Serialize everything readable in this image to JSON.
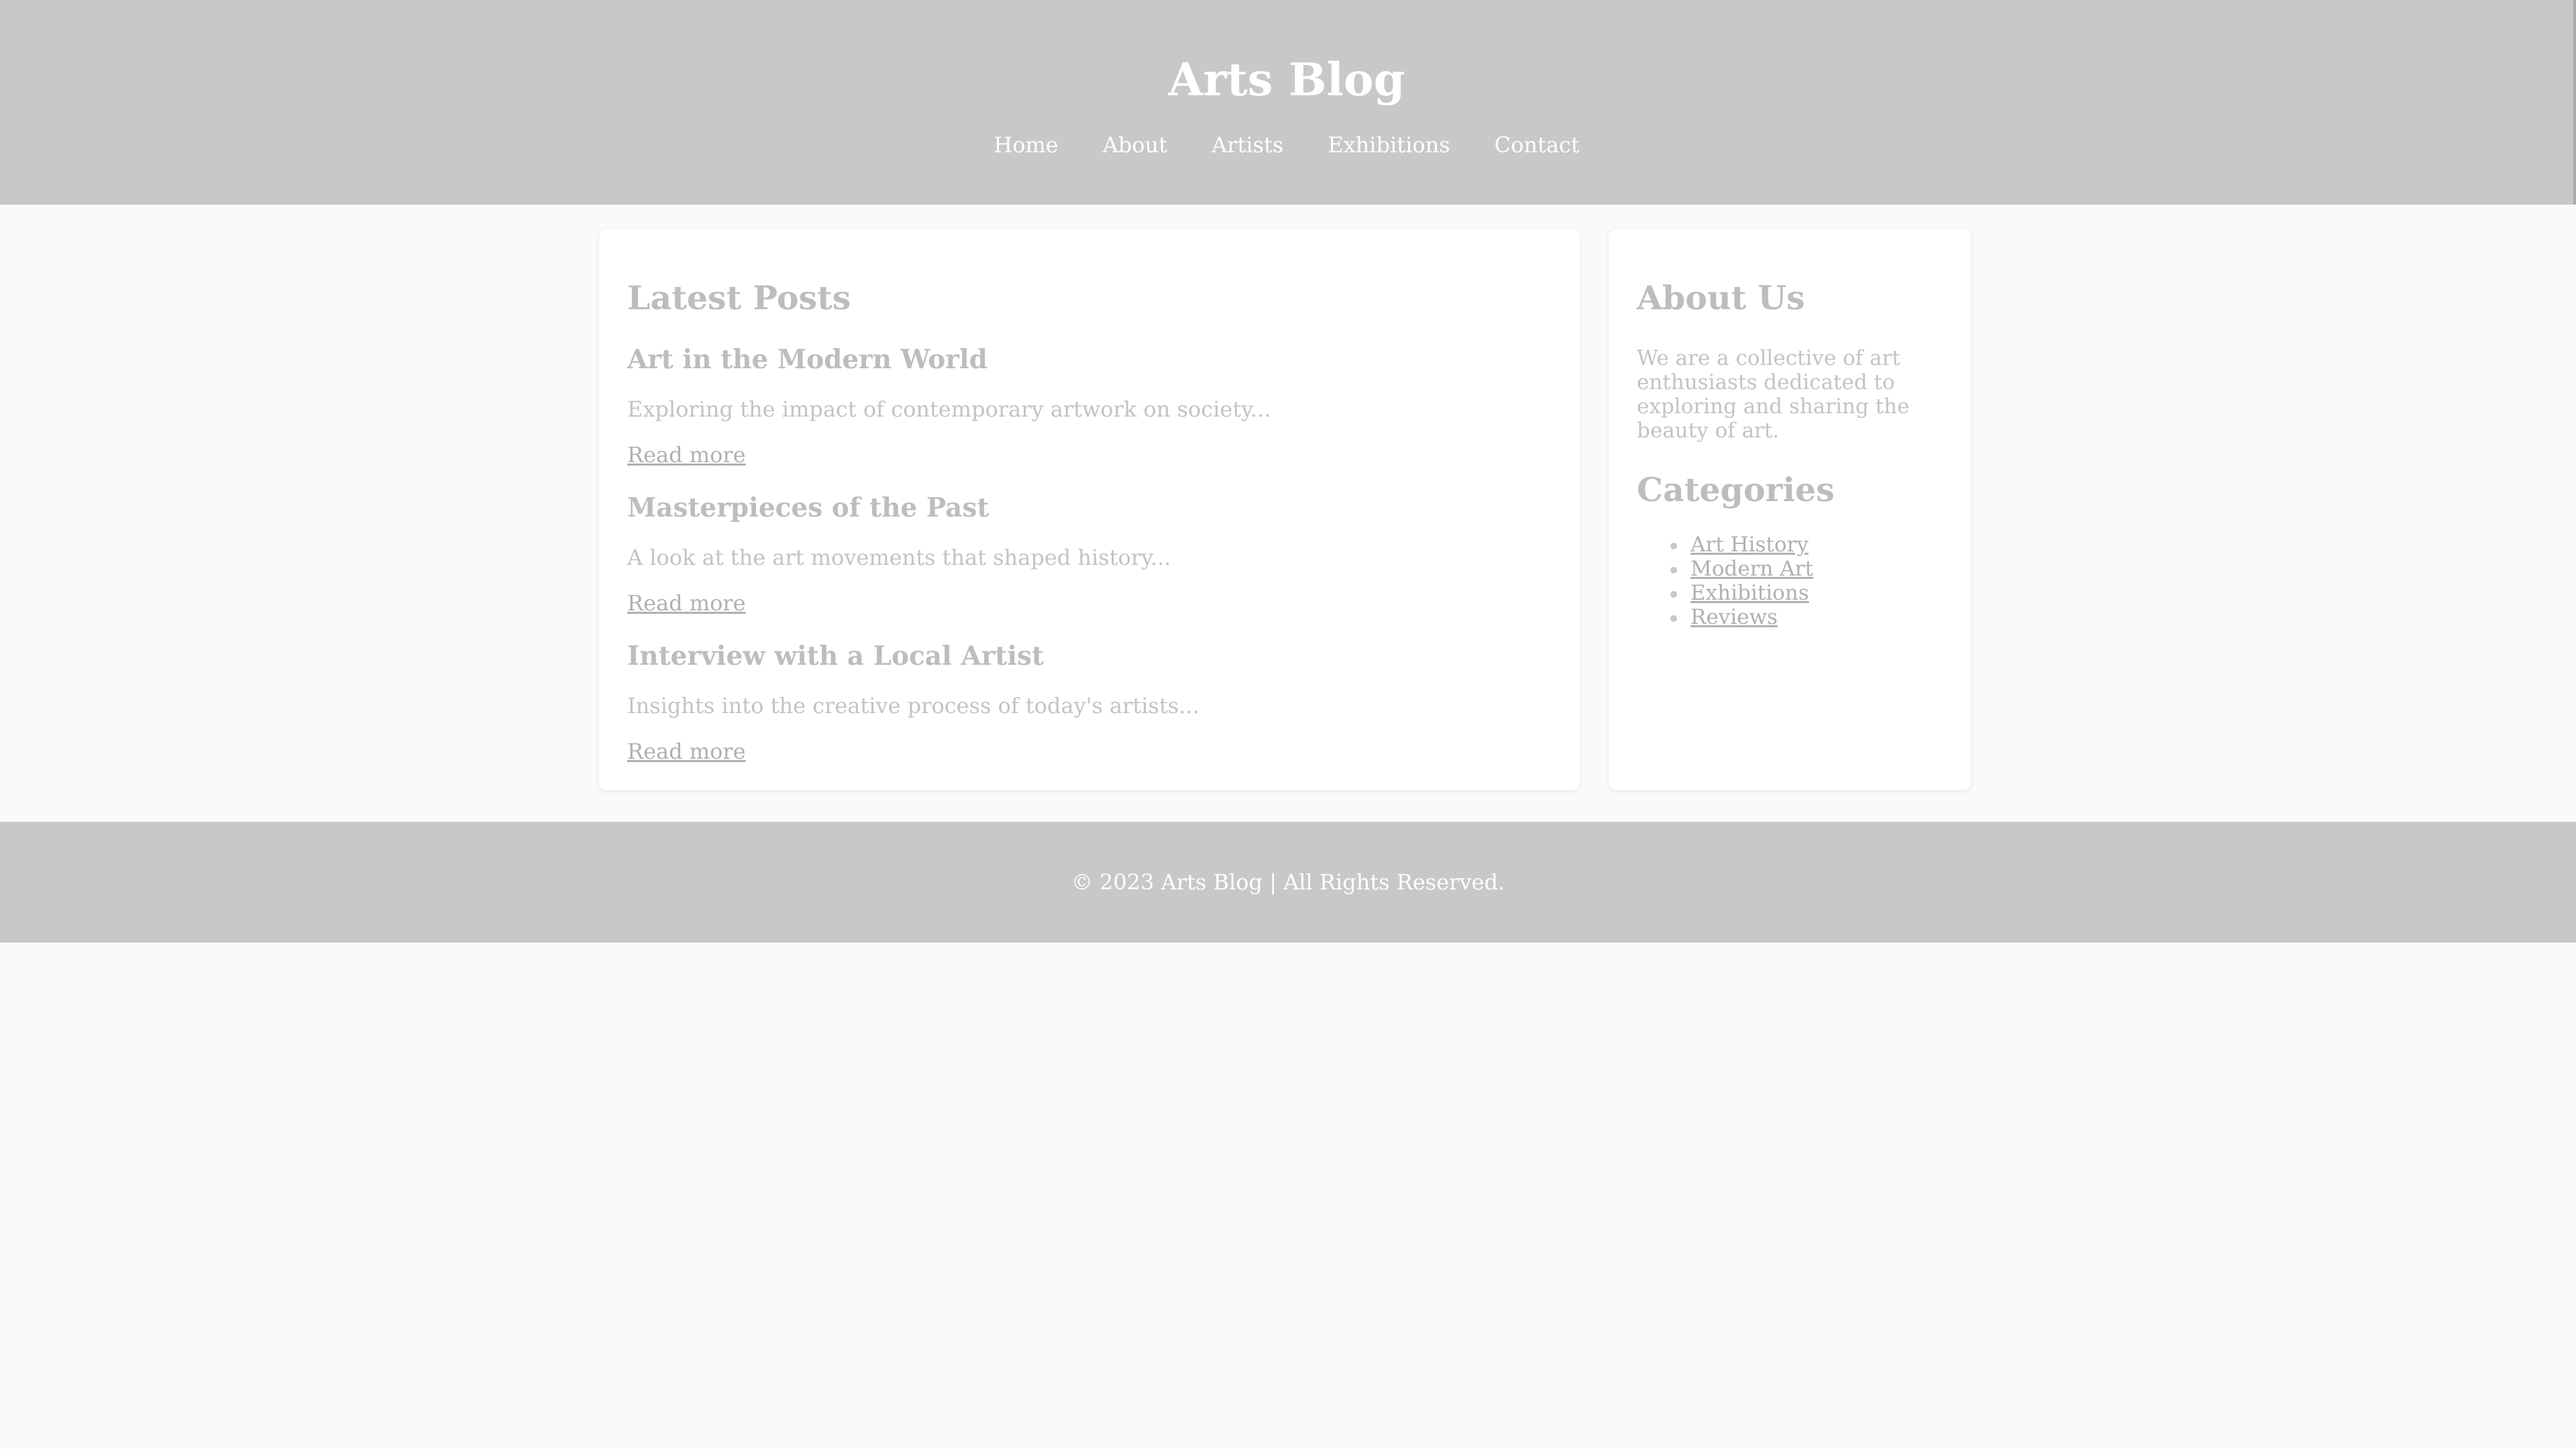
{
  "header": {
    "title": "Arts Blog",
    "nav": [
      "Home",
      "About",
      "Artists",
      "Exhibitions",
      "Contact"
    ]
  },
  "main": {
    "heading": "Latest Posts",
    "posts": [
      {
        "title": "Art in the Modern World",
        "excerpt": "Exploring the impact of contemporary artwork on society...",
        "link": "Read more"
      },
      {
        "title": "Masterpieces of the Past",
        "excerpt": "A look at the art movements that shaped history...",
        "link": "Read more"
      },
      {
        "title": "Interview with a Local Artist",
        "excerpt": "Insights into the creative process of today's artists...",
        "link": "Read more"
      }
    ]
  },
  "sidebar": {
    "about_heading": "About Us",
    "about_text": "We are a collective of art enthusiasts dedicated to exploring and sharing the beauty of art.",
    "categories_heading": "Categories",
    "categories": [
      "Art History",
      "Modern Art",
      "Exhibitions",
      "Reviews"
    ]
  },
  "footer": {
    "text": "© 2023 Arts Blog | All Rights Reserved."
  }
}
